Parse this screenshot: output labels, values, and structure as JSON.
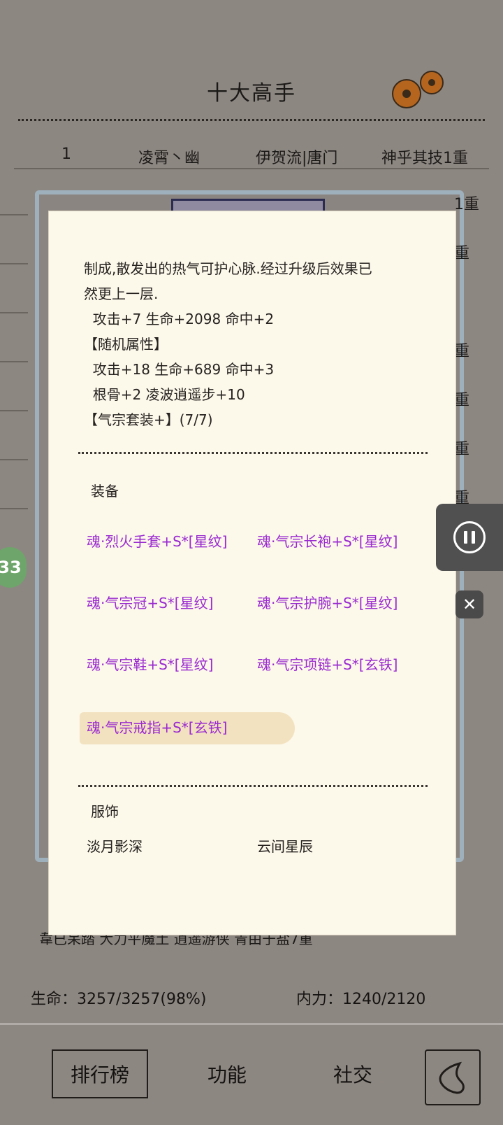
{
  "background": {
    "title": "十大高手",
    "rank_row": {
      "rank": "1",
      "name": "凌霄丶幽",
      "school": "伊贺流|唐门",
      "skill": "神乎其技1重"
    },
    "right_fragments": [
      "1重",
      "重",
      "重",
      "重",
      "重",
      "重",
      "重"
    ],
    "bottom_fragment": "韋已呆踏  大力平魔土  逍遥游侠  青由于盐7重",
    "hp_label": "生命：3257/3257(98%)",
    "mp_label": "内力：1240/2120",
    "side_badge": "33"
  },
  "nav": {
    "rank_label": "排行榜",
    "function_label": "功能",
    "social_label": "社交"
  },
  "modal": {
    "description_lines": [
      "制成,散发出的热气可护心脉.经过升级后效果已",
      "然更上一层.",
      "  攻击+7 生命+2098 命中+2",
      "【随机属性】",
      "  攻击+18 生命+689 命中+3",
      "  根骨+2 凌波逍遥步+10",
      "【气宗套装+】(7/7)"
    ],
    "equipment_title": "装备",
    "equipment": [
      "魂·烈火手套+S*[星纹]",
      "魂·气宗长袍+S*[星纹]",
      "魂·气宗冠+S*[星纹]",
      "魂·气宗护腕+S*[星纹]",
      "魂·气宗鞋+S*[星纹]",
      "魂·气宗项链+S*[玄铁]",
      "魂·气宗戒指+S*[玄铁]"
    ],
    "costume_title": "服饰",
    "costumes": [
      "淡月影深",
      "云间星辰"
    ]
  },
  "controls": {
    "close_glyph": "✕"
  },
  "colors": {
    "equipment_text": "#9a2ad0",
    "modal_bg": "#fcf8ea",
    "page_bg": "#8d8782"
  }
}
